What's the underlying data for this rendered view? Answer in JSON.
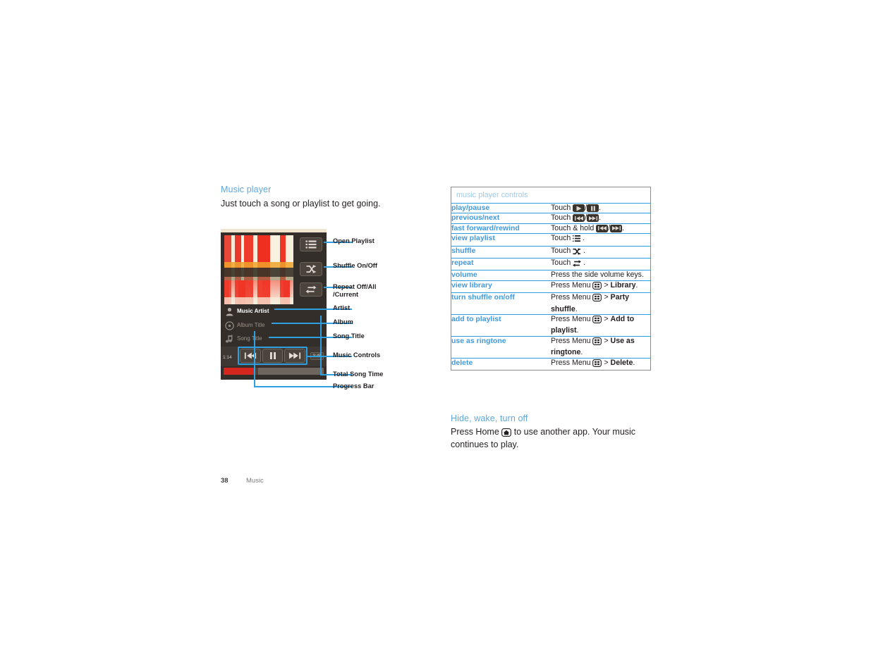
{
  "page": {
    "number": "38",
    "chapter": "Music"
  },
  "left": {
    "heading": "Music player",
    "intro": "Just touch a song or playlist to get going.",
    "phone": {
      "artist_label": "Music Artist",
      "album_label": "Album Title",
      "song_label": "Song Title",
      "time_elapsed": "1:14",
      "time_total": "3:45",
      "progress_percent": 31,
      "icons": {
        "playlist": "playlist-icon",
        "shuffle": "shuffle-icon",
        "repeat": "repeat-icon",
        "artist": "artist-icon",
        "album": "disc-icon",
        "song": "music-note-icon",
        "previous": "previous-track-icon",
        "pause": "pause-icon",
        "next": "next-track-icon"
      }
    },
    "callouts": [
      {
        "label": "Open Playlist"
      },
      {
        "label": "Shuffle On/Off"
      },
      {
        "label": "Repeat Off/All\n/Current"
      },
      {
        "label": "Artist"
      },
      {
        "label": "Album"
      },
      {
        "label": "Song Title"
      },
      {
        "label": "Music Controls"
      },
      {
        "label": "Total Song Time"
      },
      {
        "label": "Progress Bar"
      }
    ]
  },
  "right": {
    "table_title": "music player controls",
    "rows": [
      {
        "label": "play/pause",
        "pre": "Touch ",
        "icons": [
          "play",
          "pause"
        ],
        "post": "."
      },
      {
        "label": "previous/next",
        "pre": "Touch ",
        "icons": [
          "prev",
          "next"
        ],
        "post": "."
      },
      {
        "label": "fast forward/rewind",
        "pre": "Touch & hold ",
        "icons": [
          "prev",
          "next"
        ],
        "post": "."
      },
      {
        "label": "view playlist",
        "pre": "Touch ",
        "icons": [
          "playlist"
        ],
        "post": " ."
      },
      {
        "label": "shuffle",
        "pre": "Touch ",
        "icons": [
          "shuffle"
        ],
        "post": " ."
      },
      {
        "label": "repeat",
        "pre": "Touch ",
        "icons": [
          "repeat"
        ],
        "post": " ."
      },
      {
        "label": "volume",
        "pre": "Press the side volume keys.",
        "icons": [],
        "post": ""
      },
      {
        "label": "view library",
        "pre": "Press Menu ",
        "icons": [
          "menu"
        ],
        "mid": " > ",
        "bold": "Library",
        "post": "."
      },
      {
        "label": "turn shuffle on/off",
        "pre": "Press Menu ",
        "icons": [
          "menu"
        ],
        "mid": " > ",
        "bold": "Party shuffle",
        "post": "."
      },
      {
        "label": "add to playlist",
        "pre": "Press Menu ",
        "icons": [
          "menu"
        ],
        "mid": " > ",
        "bold": "Add to playlist",
        "post": "."
      },
      {
        "label": "use as ringtone",
        "pre": "Press Menu ",
        "icons": [
          "menu"
        ],
        "mid": " > ",
        "bold": "Use as ringtone",
        "post": "."
      },
      {
        "label": "delete",
        "pre": "Press Menu ",
        "icons": [
          "menu"
        ],
        "mid": " > ",
        "bold": "Delete",
        "post": "."
      }
    ],
    "hide_wake": {
      "heading": "Hide, wake, turn off",
      "pre": "Press Home ",
      "icon": "home-icon",
      "post": " to use another app. Your music continues to play."
    }
  },
  "colors": {
    "accent_blue": "#3f9ae0",
    "heading_blue": "#5fa8dc",
    "table_title_blue": "#9ecbea",
    "leader_blue": "#2e9fe0",
    "phone_body": "#332e29",
    "progress_red": "#d3261c"
  }
}
